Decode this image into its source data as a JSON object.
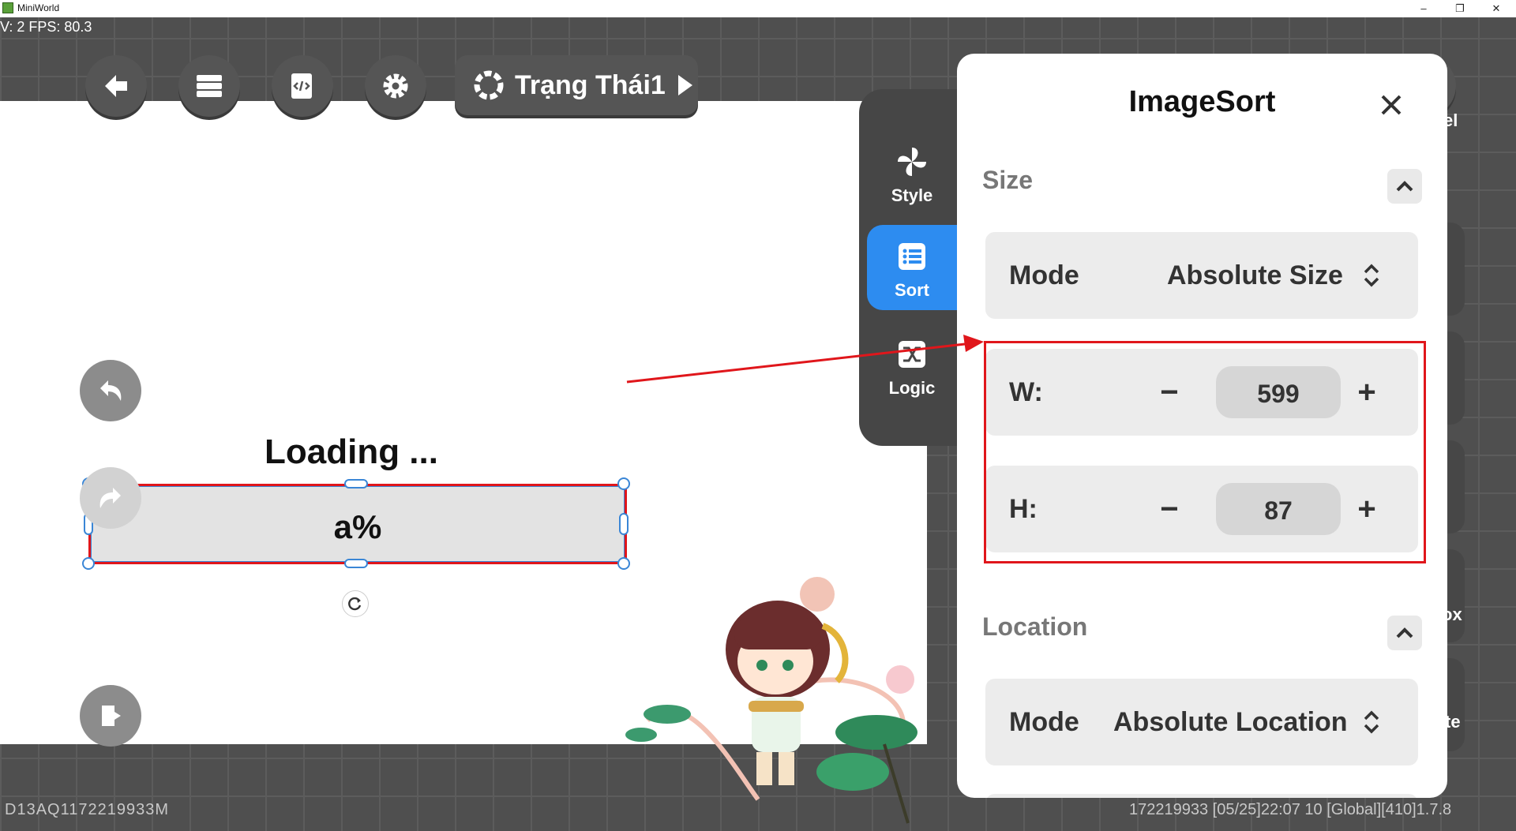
{
  "window": {
    "title": "MiniWorld",
    "minimize": "–",
    "restore": "❐",
    "close": "✕"
  },
  "debug": {
    "fps_text": "V: 2 FPS: 80.3"
  },
  "toolbar": {
    "state_label": "Trạng Thái1"
  },
  "canvas": {
    "loading_text": "Loading ...",
    "progress_text": "a%"
  },
  "tabs": [
    {
      "label": "Style",
      "icon": "pinwheel-icon",
      "active": false
    },
    {
      "label": "Sort",
      "icon": "list-icon",
      "active": true
    },
    {
      "label": "Logic",
      "icon": "shuffle-icon",
      "active": false
    }
  ],
  "right_labels": {
    "label_1": "el",
    "label_2": "ox",
    "label_3": "te"
  },
  "panel": {
    "title": "ImageSort",
    "size": {
      "section_title": "Size",
      "mode_label": "Mode",
      "mode_value": "Absolute Size",
      "w_label": "W:",
      "w_value": "599",
      "h_label": "H:",
      "h_value": "87",
      "minus": "−",
      "plus": "+"
    },
    "location": {
      "section_title": "Location",
      "mode_label": "Mode",
      "mode_value": "Absolute Location"
    }
  },
  "footer": {
    "left_id": "D13AQ1172219933M",
    "right_info": "172219933  [05/25]22:07 10  [Global][410]1.7.8"
  },
  "colors": {
    "accent_blue": "#2d8cf0",
    "highlight_red": "#e0161b",
    "selection_blue": "#3a86d6"
  }
}
